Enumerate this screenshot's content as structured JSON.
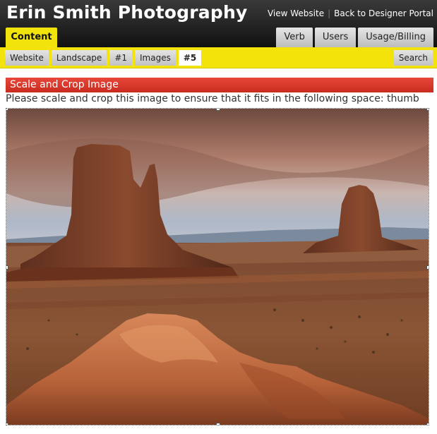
{
  "header": {
    "site_title": "Erin Smith Photography",
    "view_website": "View Website",
    "back_portal": "Back to Designer Portal",
    "separator": "|",
    "content_tab": "Content",
    "admin_tabs": [
      "Verb",
      "Users",
      "Usage/Billing"
    ]
  },
  "subnav": {
    "crumbs": [
      "Website",
      "Landscape",
      "#1",
      "Images",
      "#5"
    ],
    "active_index": 4,
    "search_label": "Search"
  },
  "section": {
    "title": "Scale and Crop Image",
    "instructions": "Please scale and crop this image to ensure that it fits in the following space: thumb"
  },
  "colors": {
    "header_bg": "#1e1e1e",
    "accent_yellow": "#f4e30a",
    "section_red": "#d8372a"
  },
  "image": {
    "icon": "landscape-photo"
  }
}
